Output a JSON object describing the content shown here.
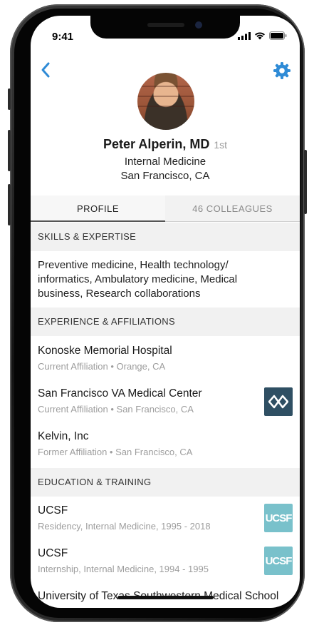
{
  "status_bar": {
    "time": "9:41"
  },
  "profile": {
    "name": "Peter Alperin, MD",
    "degree": "1st",
    "specialty": "Internal Medicine",
    "location": "San Francisco, CA"
  },
  "tabs": [
    {
      "label": "PROFILE",
      "active": true
    },
    {
      "label": "46 COLLEAGUES",
      "active": false
    }
  ],
  "skills": {
    "header": "SKILLS & EXPERTISE",
    "text": "Preventive medicine, Health technology/ informatics, Ambulatory medicine, Medical business, Research collaborations"
  },
  "experience": {
    "header": "EXPERIENCE & AFFILIATIONS",
    "items": [
      {
        "title": "Konoske Memorial Hospital",
        "subtitle": "Current Affiliation • Orange, CA",
        "logo": ""
      },
      {
        "title": "San Francisco VA Medical Center",
        "subtitle": "Current Affiliation • San Francisco, CA",
        "logo": "va-logo-icon"
      },
      {
        "title": "Kelvin, Inc",
        "subtitle": "Former Affiliation • San Francisco, CA",
        "logo": ""
      }
    ]
  },
  "education": {
    "header": "EDUCATION & TRAINING",
    "logo_text": "UCSF",
    "items": [
      {
        "title": "UCSF",
        "subtitle": "Residency, Internal Medicine, 1995 - 2018",
        "logo": "ucsf-logo-icon"
      },
      {
        "title": "UCSF",
        "subtitle": "Internship, Internal Medicine, 1994 - 1995",
        "logo": "ucsf-logo-icon"
      },
      {
        "title": "University of Texas Southwestern Medical School",
        "subtitle": "",
        "logo": ""
      }
    ]
  },
  "colors": {
    "accent": "#2f8bd6",
    "va_logo": "#2f4f63",
    "ucsf_logo": "#79c1cb"
  },
  "icons": [
    "back-chevron-icon",
    "gear-icon",
    "signal-icon",
    "wifi-icon",
    "battery-icon"
  ]
}
